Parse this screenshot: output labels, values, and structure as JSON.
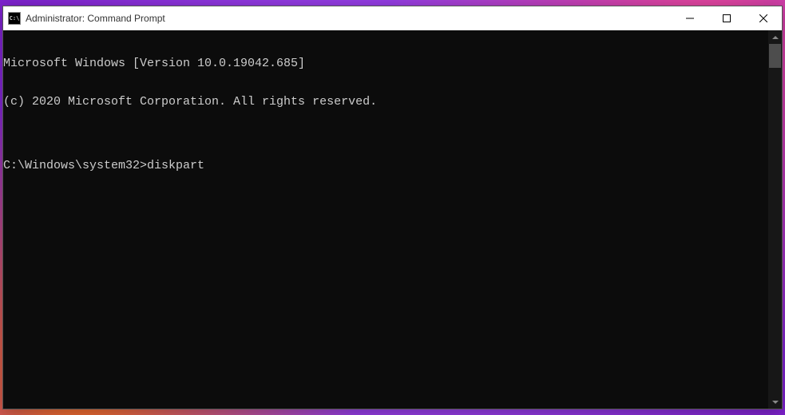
{
  "window": {
    "title": "Administrator: Command Prompt",
    "icon_label": "C:\\"
  },
  "terminal": {
    "lines": [
      "Microsoft Windows [Version 10.0.19042.685]",
      "(c) 2020 Microsoft Corporation. All rights reserved.",
      "",
      "C:\\Windows\\system32>diskpart"
    ]
  },
  "controls": {
    "minimize": "─",
    "maximize": "☐",
    "close": "✕"
  }
}
